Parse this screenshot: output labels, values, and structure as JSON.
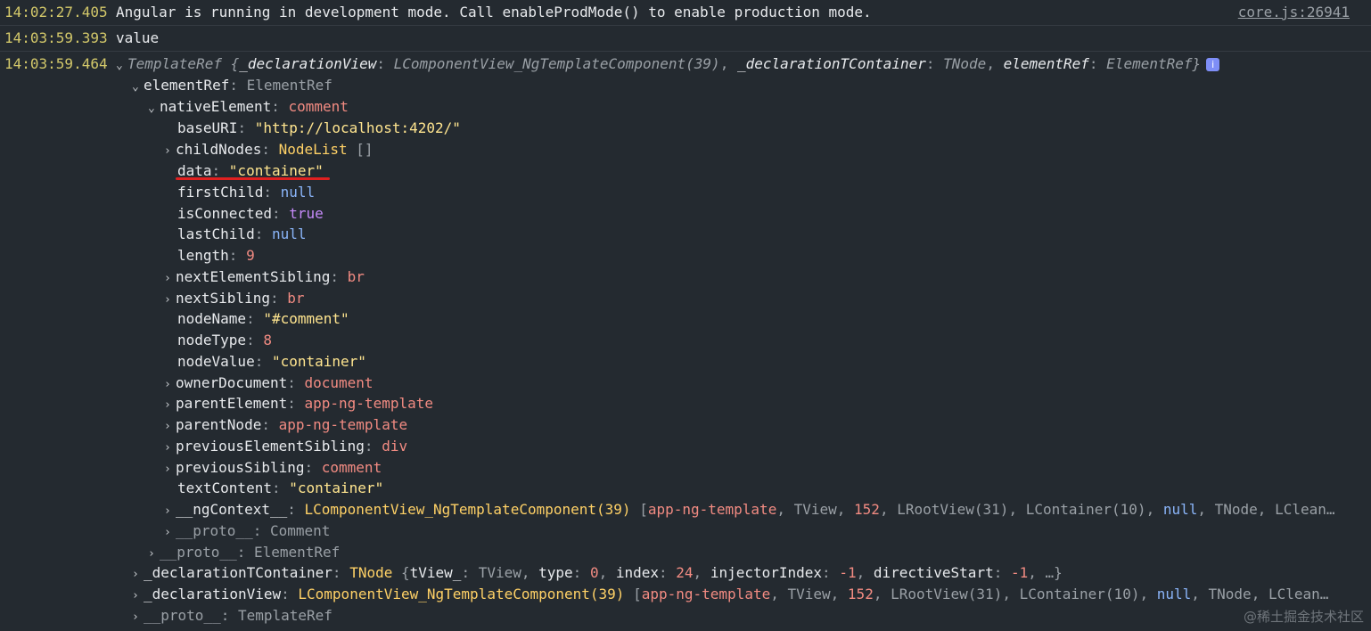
{
  "console": {
    "entries": [
      {
        "time": "14:02:27.405",
        "text": "Angular is running in development mode. Call enableProdMode() to enable production mode.",
        "source": "core.js:26941"
      },
      {
        "time": "14:03:59.393",
        "text": "value"
      },
      {
        "time": "14:03:59.464"
      }
    ]
  },
  "templateRef": {
    "class": "TemplateRef",
    "brace_open": "{",
    "k1": "_declarationView",
    "v1": "LComponentView_NgTemplateComponent(39)",
    "k2": "_declarationTContainer",
    "v2": "TNode",
    "k3": "elementRef",
    "v3": "ElementRef",
    "brace_close": "}",
    "info": "i"
  },
  "rows": {
    "elementRef": {
      "key": "elementRef",
      "value": "ElementRef"
    },
    "nativeElement": {
      "key": "nativeElement",
      "value": "comment"
    },
    "baseURI": {
      "key": "baseURI",
      "value": "\"http://localhost:4202/\""
    },
    "childNodes": {
      "key": "childNodes",
      "value": "NodeList",
      "extra": "[]"
    },
    "data": {
      "key": "data",
      "value": "\"container\""
    },
    "firstChild": {
      "key": "firstChild",
      "value": "null"
    },
    "isConnected": {
      "key": "isConnected",
      "value": "true"
    },
    "lastChild": {
      "key": "lastChild",
      "value": "null"
    },
    "length": {
      "key": "length",
      "value": "9"
    },
    "nextElementSibling": {
      "key": "nextElementSibling",
      "value": "br"
    },
    "nextSibling": {
      "key": "nextSibling",
      "value": "br"
    },
    "nodeName": {
      "key": "nodeName",
      "value": "\"#comment\""
    },
    "nodeType": {
      "key": "nodeType",
      "value": "8"
    },
    "nodeValue": {
      "key": "nodeValue",
      "value": "\"container\""
    },
    "ownerDocument": {
      "key": "ownerDocument",
      "value": "document"
    },
    "parentElement": {
      "key": "parentElement",
      "value": "app-ng-template"
    },
    "parentNode": {
      "key": "parentNode",
      "value": "app-ng-template"
    },
    "previousElementSibling": {
      "key": "previousElementSibling",
      "value": "div"
    },
    "previousSibling": {
      "key": "previousSibling",
      "value": "comment"
    },
    "textContent": {
      "key": "textContent",
      "value": "\"container\""
    },
    "ngContext": {
      "key": "__ngContext__",
      "cls": "LComponentView_NgTemplateComponent(39)",
      "open": "[",
      "a1": "app-ng-template",
      "a2": "TView",
      "a3": "152",
      "a4": "LRootView(31)",
      "a5": "LContainer(10)",
      "a6": "null",
      "a7": "TNode",
      "a8": "LClean…"
    },
    "proto_comment": {
      "key": "__proto__",
      "value": "Comment"
    },
    "proto_elementref": {
      "key": "__proto__",
      "value": "ElementRef"
    },
    "declTContainer": {
      "key": "_declarationTContainer",
      "cls": "TNode",
      "open": "{",
      "k1": "tView_",
      "v1": "TView",
      "k2": "type",
      "v2": "0",
      "k3": "index",
      "v3": "24",
      "k4": "injectorIndex",
      "v4": "-1",
      "k5": "directiveStart",
      "v5": "-1",
      "tail": "…}"
    },
    "declView": {
      "key": "_declarationView",
      "cls": "LComponentView_NgTemplateComponent(39)",
      "open": "[",
      "a1": "app-ng-template",
      "a2": "TView",
      "a3": "152",
      "a4": "LRootView(31)",
      "a5": "LContainer(10)",
      "a6": "null",
      "a7": "TNode",
      "a8": "LClean…"
    },
    "proto_templateref": {
      "key": "__proto__",
      "value": "TemplateRef"
    }
  },
  "watermark": "@稀土掘金技术社区"
}
